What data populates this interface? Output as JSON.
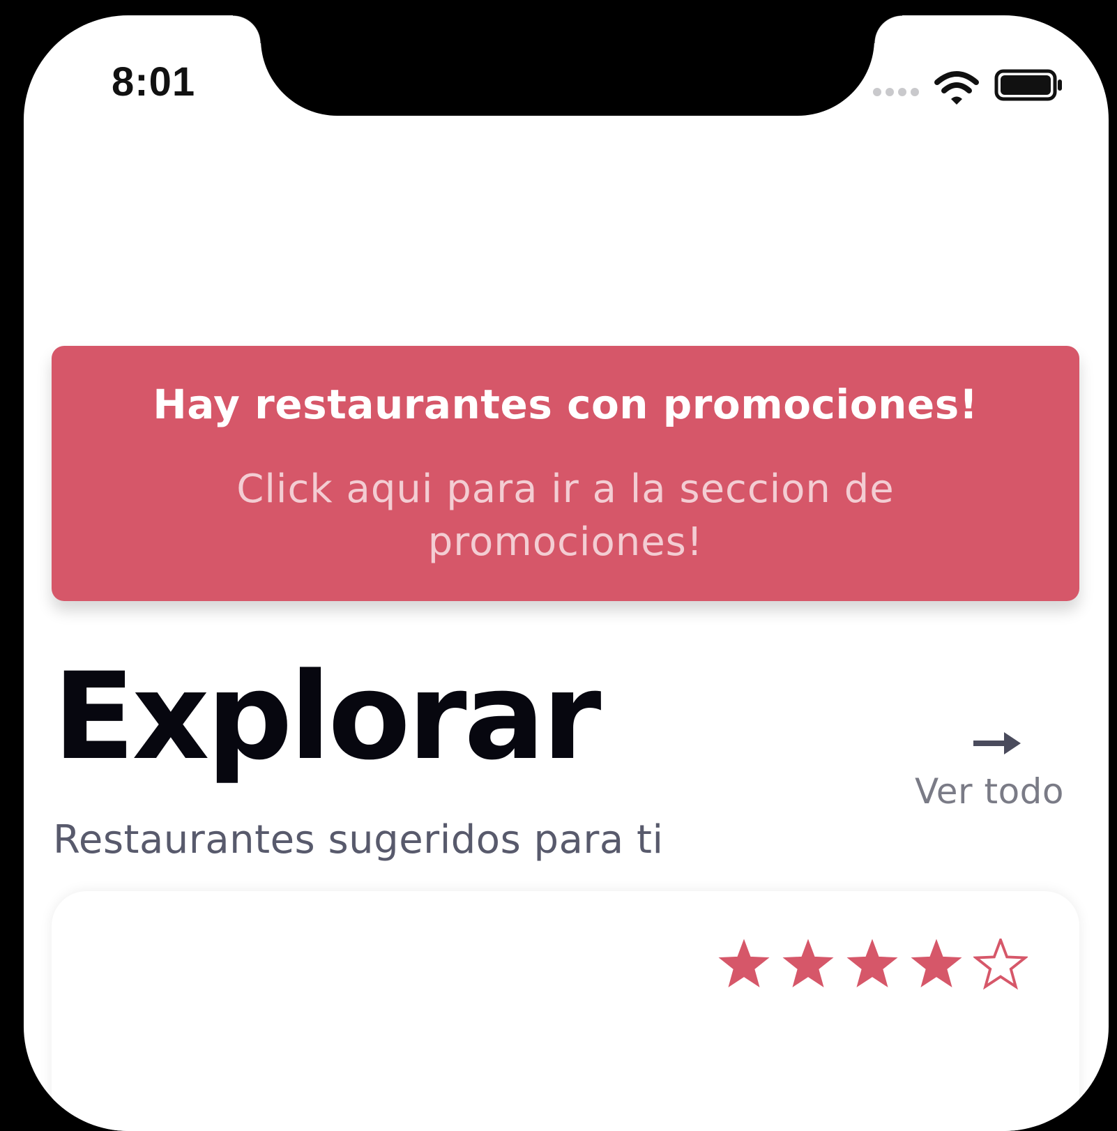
{
  "status_bar": {
    "time": "8:01"
  },
  "promo_banner": {
    "title": "Hay restaurantes con promociones!",
    "subtitle": "Click aqui para ir a la seccion de promociones!",
    "color": "#d65769"
  },
  "explore": {
    "title": "Explorar",
    "subtitle": "Restaurantes sugeridos para ti",
    "see_all_label": "Ver todo"
  },
  "restaurant_card": {
    "rating": 4,
    "rating_max": 5,
    "star_color": "#d65769"
  }
}
